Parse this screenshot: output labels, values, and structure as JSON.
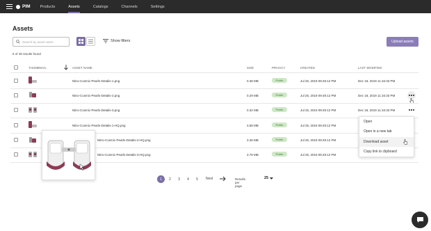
{
  "nav": {
    "logo": "PIM",
    "items": [
      {
        "label": "Products",
        "active": false
      },
      {
        "label": "Assets",
        "active": true
      },
      {
        "label": "Catalogs",
        "active": false
      },
      {
        "label": "Channels",
        "active": false
      },
      {
        "label": "Settings",
        "active": false
      }
    ]
  },
  "page": {
    "title": "Assets",
    "search_placeholder": "Search by asset name",
    "filters_label": "Show filters",
    "upload_label": "Upload assets",
    "results_count": "6 of 49 results found"
  },
  "table": {
    "headers": {
      "thumbnail": "THUMBNAIL",
      "asset_name": "ASSET NAME",
      "size": "SIZE",
      "privacy": "PRIVACY",
      "created": "CREATED",
      "last_modified": "LAST MODIFIED"
    },
    "rows": [
      {
        "name": "Nitro-Cosmic-Pearls-Detalis-1.png",
        "size": "0.38 MB",
        "privacy": "Public",
        "created": "Jul 25, 2019 09:49:12 PM",
        "modified": "Dec 18, 2019 11:16:33 PM"
      },
      {
        "name": "Nitro-Cosmic-Pearls-Detalis-2.png",
        "size": "0.29 MB",
        "privacy": "Public",
        "created": "Jul 25, 2019 09:49:12 PM",
        "modified": "Dec 18, 2019 11:16:33 PM"
      },
      {
        "name": "Nitro-Cosmic-Pearls-Detalis-3.png",
        "size": "0.32 MB",
        "privacy": "Public",
        "created": "Jul 25, 2019 09:49:12 PM",
        "modified": "Dec 18, 2019 11:16:33 PM"
      },
      {
        "name": "Nitro-Cosmic-Pearls-Detalis-1-HQ.png",
        "size": "3.58 MB",
        "privacy": "Public",
        "created": "Jul 25, 2019 09:49:12 PM",
        "modified": "Dec 18, 2019 11:16:33 PM"
      },
      {
        "name": "Nitro-Cosmic-Pearls-Detalis-2-HQ.png",
        "size": "3.48 MB",
        "privacy": "Public",
        "created": "Jul 25, 2019 09:49:12 PM",
        "modified": "Dec 18, 2019 11:16:33 PM"
      },
      {
        "name": "Nitro-Cosmic-Pearls-Detalis-3-HQ.png",
        "size": "3.79 MB",
        "privacy": "Public",
        "created": "Jul 25, 2019 09:49:12 PM",
        "modified": "Dec 18, 2019 11:16:33 PM"
      }
    ]
  },
  "context_menu": {
    "items": [
      "Open",
      "Open in a new tab",
      "Download asset",
      "Copy link to clipboard"
    ]
  },
  "pagination": {
    "pages": [
      "1",
      "2",
      "3",
      "4",
      "5"
    ],
    "current": "1",
    "next_label": "Next",
    "per_page_label": "Results per page",
    "per_page_value": "25"
  },
  "colors": {
    "accent": "#7b6ea8",
    "topbar": "#2b2b2b",
    "badge_bg": "#cfe8c7",
    "badge_text": "#3e7a37"
  }
}
